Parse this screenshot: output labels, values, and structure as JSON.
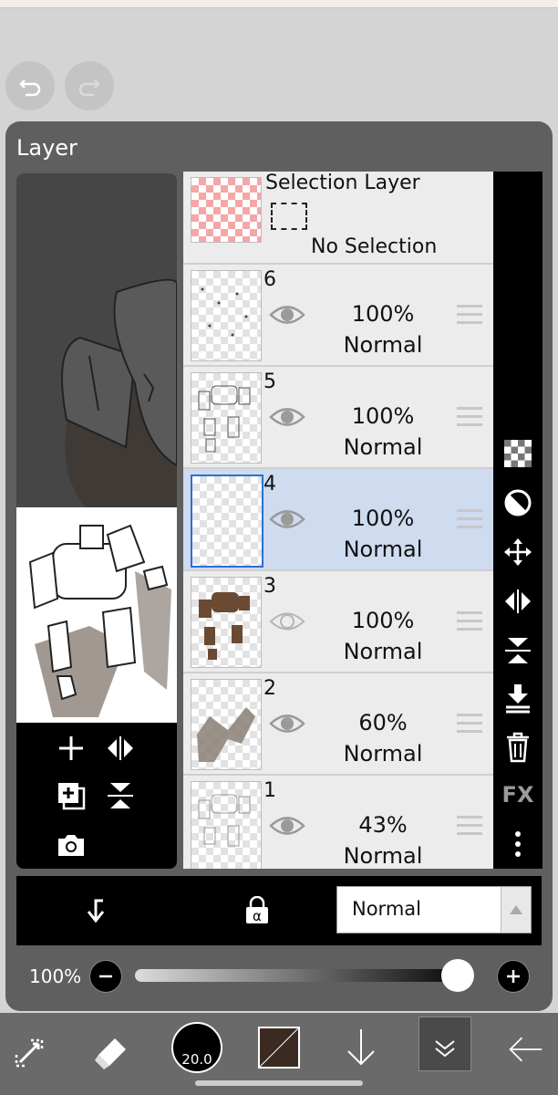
{
  "panel": {
    "title": "Layer"
  },
  "selection_layer": {
    "name": "Selection Layer",
    "status": "No Selection"
  },
  "layers": [
    {
      "number": "6",
      "opacity": "100%",
      "blend": "Normal",
      "visible": true,
      "selected": false
    },
    {
      "number": "5",
      "opacity": "100%",
      "blend": "Normal",
      "visible": true,
      "selected": false
    },
    {
      "number": "4",
      "opacity": "100%",
      "blend": "Normal",
      "visible": true,
      "selected": true
    },
    {
      "number": "3",
      "opacity": "100%",
      "blend": "Normal",
      "visible": false,
      "selected": false
    },
    {
      "number": "2",
      "opacity": "60%",
      "blend": "Normal",
      "visible": true,
      "selected": false
    },
    {
      "number": "1",
      "opacity": "43%",
      "blend": "Normal",
      "visible": true,
      "selected": false
    }
  ],
  "right_bar": {
    "fx_label": "FX"
  },
  "bottom_bar": {
    "blend_mode": "Normal"
  },
  "opacity_row": {
    "value": "100%",
    "level": 1.0
  },
  "toolbar": {
    "brush_size": "20.0"
  },
  "colors": {
    "accent": "#2d6fd6",
    "selected_row": "#cfdbef",
    "panel_bg": "#5f5f5f",
    "main_color": "#3a2a22"
  }
}
